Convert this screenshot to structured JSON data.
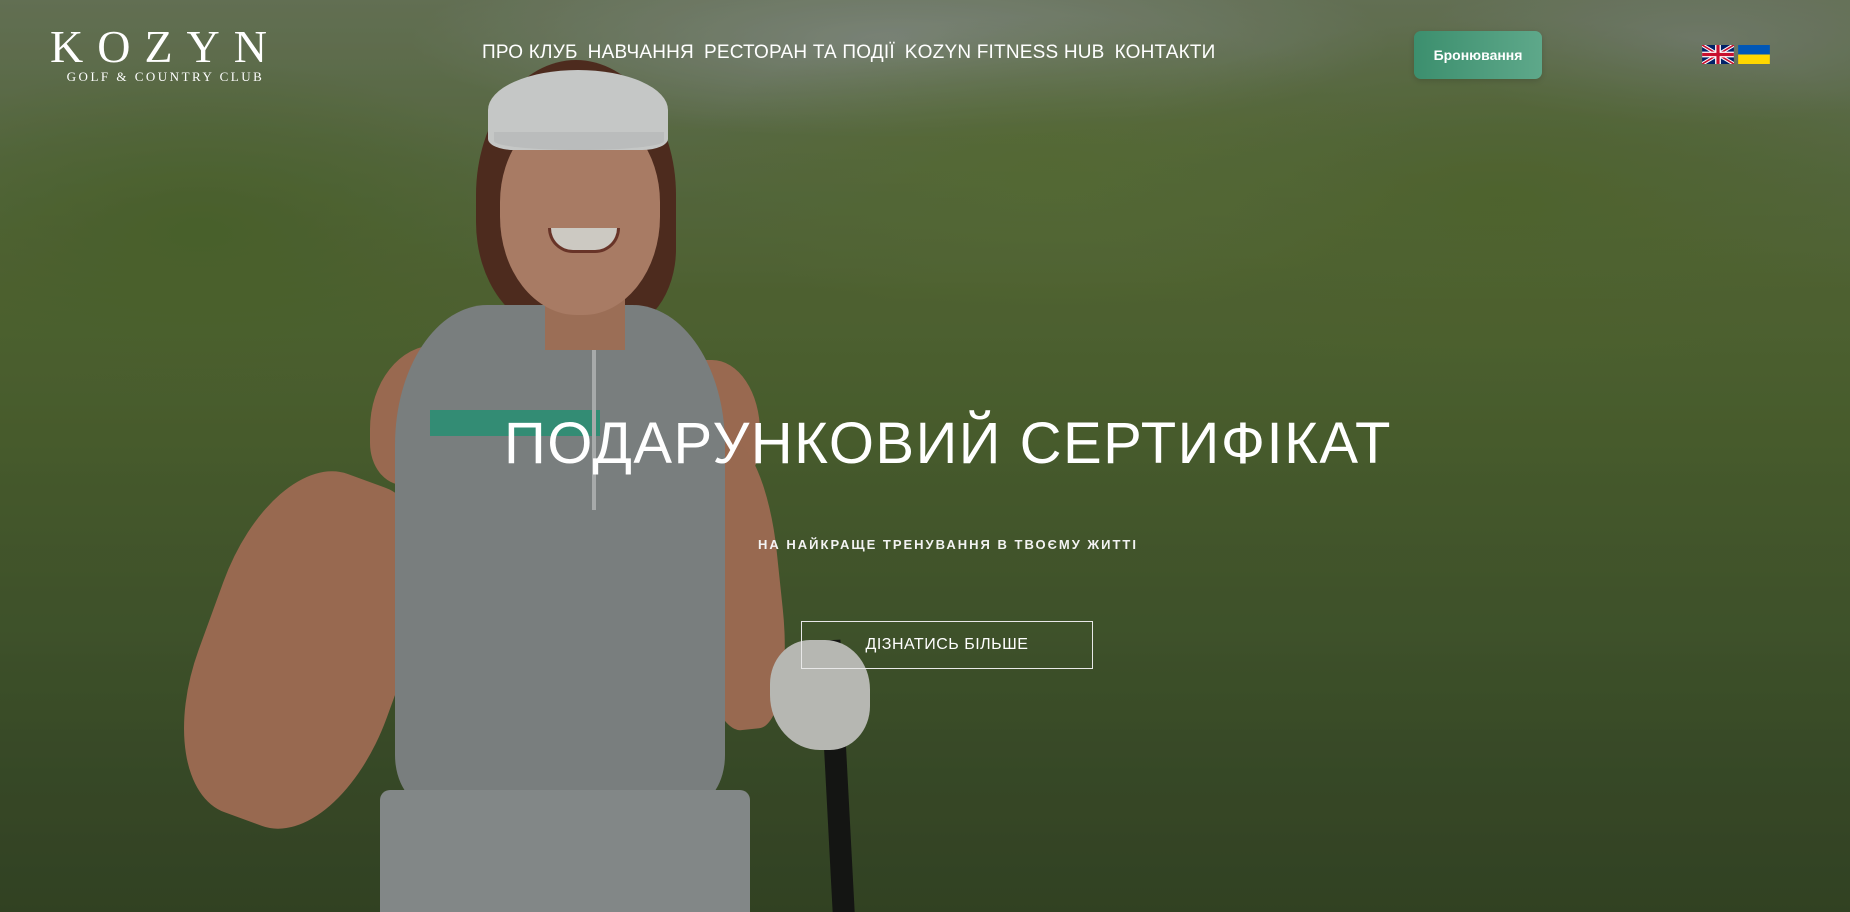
{
  "header": {
    "logo": {
      "word": "KOZYN",
      "subtitle": "GOLF & COUNTRY CLUB"
    },
    "nav": [
      {
        "label": "ПРО КЛУБ"
      },
      {
        "label": "НАВЧАННЯ"
      },
      {
        "label": "РЕСТОРАН ТА ПОДІЇ"
      },
      {
        "label": "KOZYN FITNESS HUB"
      },
      {
        "label": "КОНТАКТИ"
      }
    ],
    "booking_label": "Бронювання",
    "languages": [
      {
        "icon": "uk-flag-icon"
      },
      {
        "icon": "ukraine-flag-icon"
      }
    ]
  },
  "hero": {
    "title": "ПОДАРУНКОВИЙ СЕРТИФІКАТ",
    "subtitle": "НА НАЙКРАЩЕ ТРЕНУВАННЯ В ТВОЄМУ ЖИТТІ",
    "cta_label": "ДІЗНАТИСЬ БІЛЬШЕ"
  },
  "colors": {
    "accent": "#4a9b7c",
    "text": "#ffffff"
  }
}
